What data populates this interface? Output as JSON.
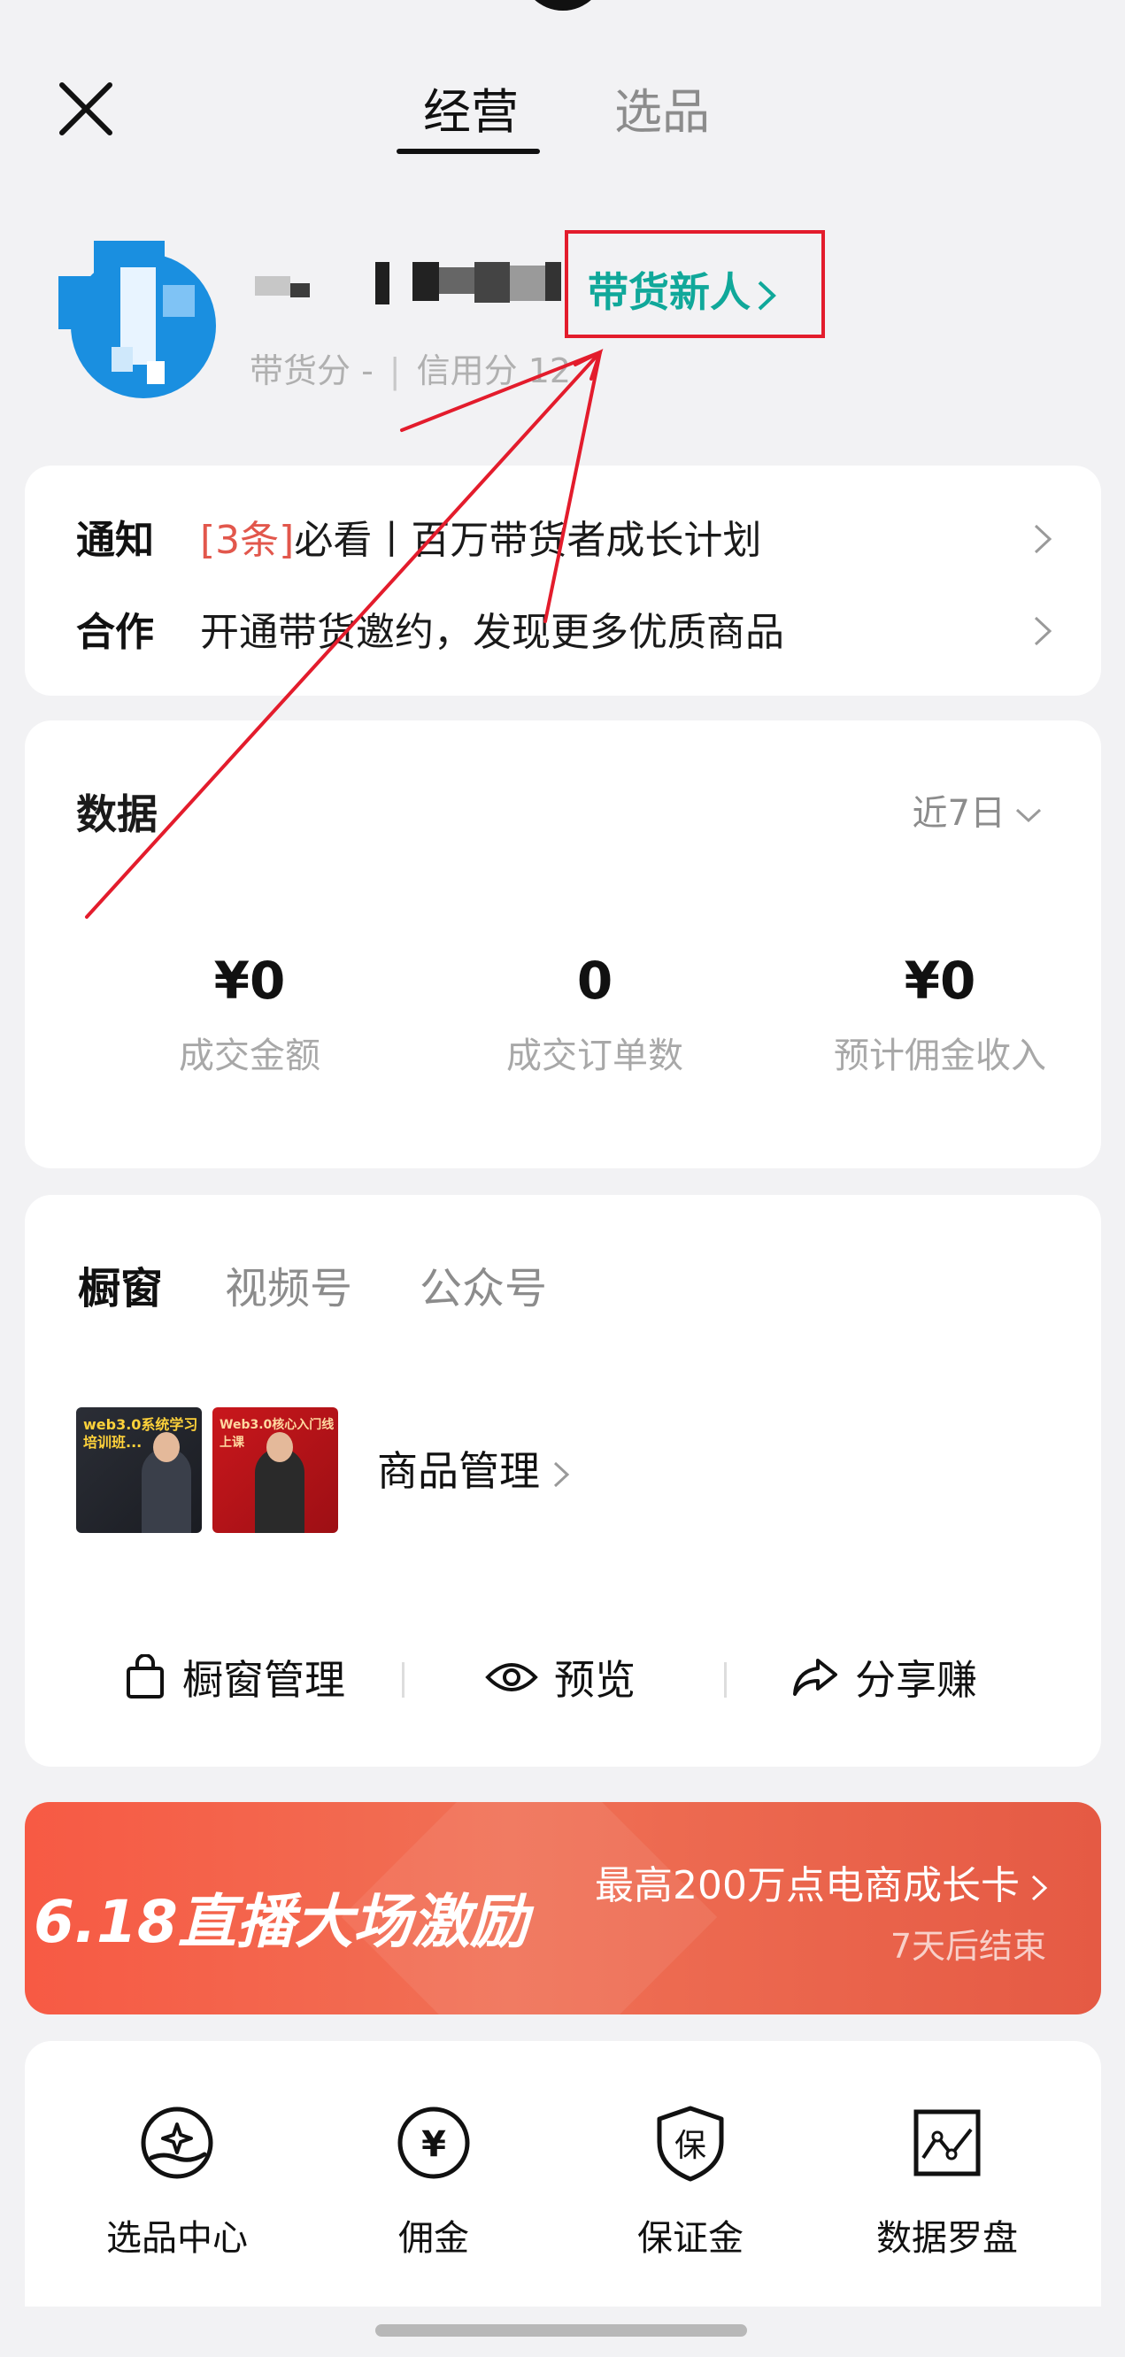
{
  "header": {
    "tabs": [
      {
        "label": "经营",
        "active": true
      },
      {
        "label": "选品",
        "active": false
      }
    ]
  },
  "profile": {
    "badge": "带货新人",
    "sales_score_label": "带货分 -",
    "credit_score_label": "信用分 12"
  },
  "notices": [
    {
      "label": "通知",
      "highlight": "[3条]",
      "text": "必看丨百万带货者成长计划"
    },
    {
      "label": "合作",
      "highlight": "",
      "text": "开通带货邀约，发现更多优质商品"
    }
  ],
  "data_section": {
    "title": "数据",
    "period": "近7日",
    "metrics": [
      {
        "value": "¥0",
        "label": "成交金额"
      },
      {
        "value": "0",
        "label": "成交订单数"
      },
      {
        "value": "¥0",
        "label": "预计佣金收入"
      }
    ]
  },
  "showcase": {
    "tabs": [
      "橱窗",
      "视频号",
      "公众号"
    ],
    "thumbs": [
      {
        "caption": "web3.0系统学习 培训班..."
      },
      {
        "caption": "Web3.0核心入门线上课"
      }
    ],
    "goods_label": "商品管理",
    "actions": [
      {
        "label": "橱窗管理",
        "icon": "shopping-bag-icon"
      },
      {
        "label": "预览",
        "icon": "eye-icon"
      },
      {
        "label": "分享赚",
        "icon": "share-icon"
      }
    ]
  },
  "promo": {
    "title": "6.18直播大场激励",
    "right_text": "最高200万点电商成长卡",
    "sub_text": "7天后结束",
    "colors": {
      "start": "#f75a44",
      "end": "#e55a44"
    }
  },
  "tools": [
    {
      "label": "选品中心",
      "icon": "hand-sparkle-icon"
    },
    {
      "label": "佣金",
      "icon": "yen-circle-icon"
    },
    {
      "label": "保证金",
      "icon": "shield-icon",
      "glyph": "保"
    },
    {
      "label": "数据罗盘",
      "icon": "chart-frame-icon"
    }
  ],
  "colors": {
    "accent_teal": "#10a89a",
    "annotation_red": "#e31c2c",
    "notice_highlight": "#e2574c"
  }
}
